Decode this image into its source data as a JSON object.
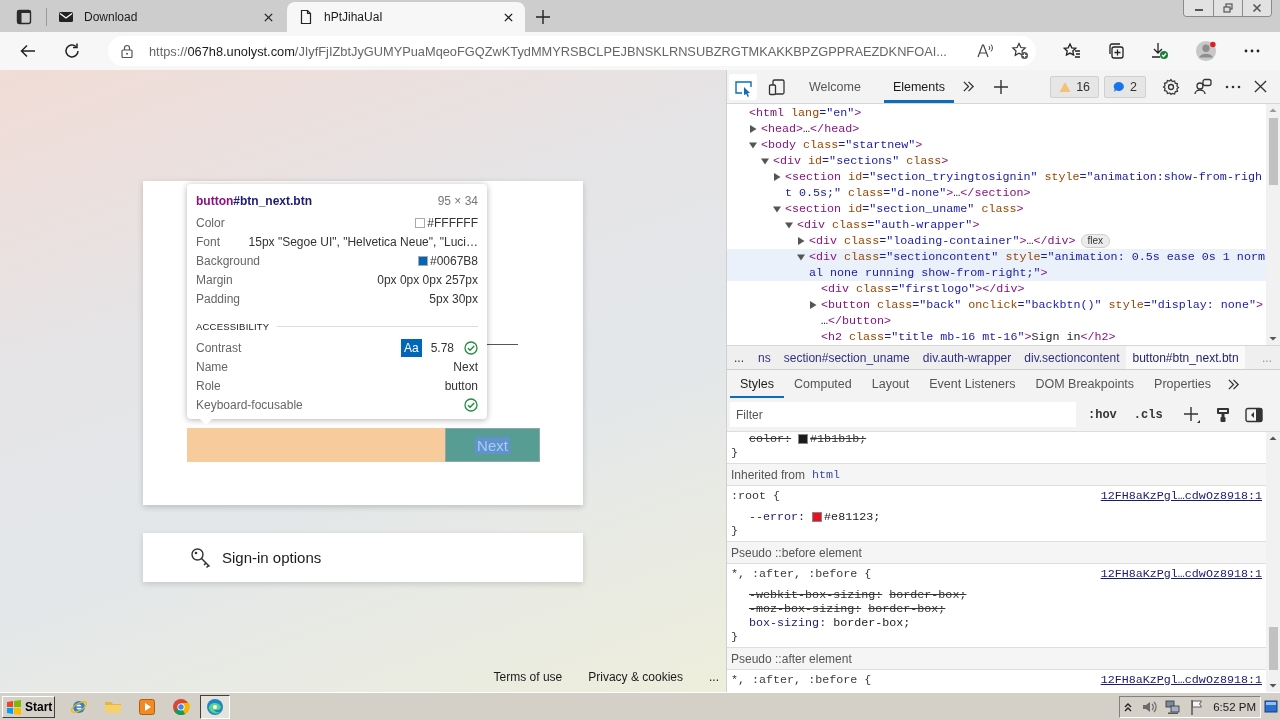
{
  "browser": {
    "tabs": [
      {
        "title": "Download",
        "selected": false
      },
      {
        "title": "hPtJihaUaI",
        "selected": true
      }
    ],
    "address": {
      "scheme": "https://",
      "host": "067h8.unolyst.com",
      "path": "/JIyfFjIZbtJyGUMYPuaMqeoFGQZwKTydMMYRSBCLPEJBNSKLRNSUBZRGTMKAKKBPZGPPRAEZDKNFOAI..."
    }
  },
  "page": {
    "inspect_tooltip": {
      "selector": {
        "tag": "button",
        "rest": "#btn_next.btn"
      },
      "size": "95 × 34",
      "properties": [
        {
          "kind": "color",
          "label": "Color",
          "value": "#FFFFFF",
          "color": "#ffffff"
        },
        {
          "kind": "text",
          "label": "Font",
          "value": "15px \"Segoe UI\", \"Helvetica Neue\", \"Luci…"
        },
        {
          "kind": "color",
          "label": "Background",
          "value": "#0067B8",
          "color": "#0067b8"
        },
        {
          "kind": "text",
          "label": "Margin",
          "value": "0px 0px 0px 257px"
        },
        {
          "kind": "text",
          "label": "Padding",
          "value": "5px 30px"
        }
      ],
      "accessibility_heading": "ACCESSIBILITY",
      "accessibility": [
        {
          "kind": "contrast",
          "label": "Contrast",
          "sample": "Aa",
          "value": "5.78",
          "passed": true
        },
        {
          "kind": "text",
          "label": "Name",
          "value": "Next"
        },
        {
          "kind": "text",
          "label": "Role",
          "value": "button"
        },
        {
          "kind": "check",
          "label": "Keyboard-focusable",
          "passed": true
        }
      ]
    },
    "next_button": {
      "label": "Next"
    },
    "sign_in_options": {
      "label": "Sign-in options"
    },
    "footer_links": [
      "Terms of use",
      "Privacy & cookies",
      "..."
    ]
  },
  "devtools": {
    "inspect_active": true,
    "tabs": [
      {
        "label": "Welcome",
        "selected": false
      },
      {
        "label": "Elements",
        "selected": true
      }
    ],
    "issues": {
      "warnings": "16",
      "messages": "2"
    },
    "dom_tree": [
      {
        "collapsible": false,
        "expanded": true,
        "highlighted": false,
        "tokens": [
          {
            "kind": "tag",
            "text": "<html"
          },
          {
            "kind": "attr",
            "text": " lang"
          },
          {
            "kind": "value",
            "text": "=\"en\""
          },
          {
            "kind": "tag",
            "text": ">"
          }
        ],
        "children": [
          {
            "collapsible": true,
            "expanded": false,
            "highlighted": false,
            "tokens": [
              {
                "kind": "tag",
                "text": "<head>"
              }
            ],
            "tail": [
              {
                "kind": "text",
                "text": "…"
              },
              {
                "kind": "tag",
                "text": "</head>"
              }
            ]
          },
          {
            "collapsible": true,
            "expanded": true,
            "highlighted": false,
            "tokens": [
              {
                "kind": "tag",
                "text": "<body"
              },
              {
                "kind": "attr",
                "text": " class"
              },
              {
                "kind": "value",
                "text": "=\"startnew\""
              },
              {
                "kind": "tag",
                "text": ">"
              }
            ],
            "children": [
              {
                "collapsible": true,
                "expanded": true,
                "highlighted": false,
                "tokens": [
                  {
                    "kind": "tag",
                    "text": "<div"
                  },
                  {
                    "kind": "attr",
                    "text": " id"
                  },
                  {
                    "kind": "value",
                    "text": "=\"sections\""
                  },
                  {
                    "kind": "attr",
                    "text": " class"
                  },
                  {
                    "kind": "tag",
                    "text": ">"
                  }
                ],
                "children": [
                  {
                    "collapsible": true,
                    "expanded": false,
                    "highlighted": false,
                    "tokens": [
                      {
                        "kind": "tag",
                        "text": "<section"
                      },
                      {
                        "kind": "attr",
                        "text": " id"
                      },
                      {
                        "kind": "value",
                        "text": "=\"section_tryingtosignin\""
                      },
                      {
                        "kind": "attr",
                        "text": " style"
                      },
                      {
                        "kind": "value",
                        "text": "=\"animation:show-from-right 0.5s;\""
                      },
                      {
                        "kind": "attr",
                        "text": " class"
                      },
                      {
                        "kind": "value",
                        "text": "=\"d-none\""
                      },
                      {
                        "kind": "tag",
                        "text": ">"
                      }
                    ],
                    "tail": [
                      {
                        "kind": "text",
                        "text": "…"
                      },
                      {
                        "kind": "tag",
                        "text": "</section>"
                      }
                    ]
                  },
                  {
                    "collapsible": true,
                    "expanded": true,
                    "highlighted": false,
                    "tokens": [
                      {
                        "kind": "tag",
                        "text": "<section"
                      },
                      {
                        "kind": "attr",
                        "text": " id"
                      },
                      {
                        "kind": "value",
                        "text": "=\"section_uname\""
                      },
                      {
                        "kind": "attr",
                        "text": " class"
                      },
                      {
                        "kind": "tag",
                        "text": ">"
                      }
                    ],
                    "children": [
                      {
                        "collapsible": true,
                        "expanded": true,
                        "highlighted": false,
                        "tokens": [
                          {
                            "kind": "tag",
                            "text": "<div"
                          },
                          {
                            "kind": "attr",
                            "text": " class"
                          },
                          {
                            "kind": "value",
                            "text": "=\"auth-wrapper\""
                          },
                          {
                            "kind": "tag",
                            "text": ">"
                          }
                        ],
                        "children": [
                          {
                            "collapsible": true,
                            "expanded": false,
                            "highlighted": false,
                            "badge": "flex",
                            "tokens": [
                              {
                                "kind": "tag",
                                "text": "<div"
                              },
                              {
                                "kind": "attr",
                                "text": " class"
                              },
                              {
                                "kind": "value",
                                "text": "=\"loading-container\""
                              },
                              {
                                "kind": "tag",
                                "text": ">"
                              }
                            ],
                            "tail": [
                              {
                                "kind": "text",
                                "text": "…"
                              },
                              {
                                "kind": "tag",
                                "text": "</div>"
                              }
                            ]
                          },
                          {
                            "collapsible": true,
                            "expanded": true,
                            "highlighted": true,
                            "tokens": [
                              {
                                "kind": "tag",
                                "text": "<div"
                              },
                              {
                                "kind": "attr",
                                "text": " class"
                              },
                              {
                                "kind": "value",
                                "text": "=\"sectioncontent\""
                              },
                              {
                                "kind": "attr",
                                "text": " style"
                              },
                              {
                                "kind": "value",
                                "text": "=\"animation: 0.5s ease 0s 1 normal none running show-from-right;\""
                              },
                              {
                                "kind": "tag",
                                "text": ">"
                              }
                            ],
                            "children": [
                              {
                                "collapsible": false,
                                "expanded": false,
                                "highlighted": false,
                                "tokens": [
                                  {
                                    "kind": "tag",
                                    "text": "<div"
                                  },
                                  {
                                    "kind": "attr",
                                    "text": " class"
                                  },
                                  {
                                    "kind": "value",
                                    "text": "=\"firstlogo\""
                                  },
                                  {
                                    "kind": "tag",
                                    "text": ">"
                                  }
                                ],
                                "tail": [
                                  {
                                    "kind": "tag",
                                    "text": "</div>"
                                  }
                                ]
                              },
                              {
                                "collapsible": true,
                                "expanded": false,
                                "highlighted": false,
                                "tokens": [
                                  {
                                    "kind": "tag",
                                    "text": "<button"
                                  },
                                  {
                                    "kind": "attr",
                                    "text": " class"
                                  },
                                  {
                                    "kind": "value",
                                    "text": "=\"back\""
                                  },
                                  {
                                    "kind": "attr",
                                    "text": " onclick"
                                  },
                                  {
                                    "kind": "value",
                                    "text": "=\"backbtn()\""
                                  },
                                  {
                                    "kind": "attr",
                                    "text": " style"
                                  },
                                  {
                                    "kind": "value",
                                    "text": "=\"display: none\""
                                  },
                                  {
                                    "kind": "tag",
                                    "text": ">"
                                  }
                                ],
                                "tail": [
                                  {
                                    "kind": "text",
                                    "text": "…"
                                  },
                                  {
                                    "kind": "tag",
                                    "text": "</button>"
                                  }
                                ]
                              },
                              {
                                "collapsible": false,
                                "expanded": false,
                                "highlighted": false,
                                "tokens": [
                                  {
                                    "kind": "tag",
                                    "text": "<h2"
                                  },
                                  {
                                    "kind": "attr",
                                    "text": " class"
                                  },
                                  {
                                    "kind": "value",
                                    "text": "=\"title mb-16 mt-16\""
                                  },
                                  {
                                    "kind": "tag",
                                    "text": ">"
                                  }
                                ],
                                "tail": [
                                  {
                                    "kind": "text",
                                    "text": "Sign in"
                                  },
                                  {
                                    "kind": "tag",
                                    "text": "</h2>"
                                  }
                                ]
                              }
                            ]
                          }
                        ]
                      }
                    ]
                  }
                ]
              }
            ]
          }
        ]
      }
    ],
    "breadcrumbs": {
      "scroll_left": "...",
      "items": [
        {
          "label": "ns",
          "selected": false
        },
        {
          "label": "section#section_uname",
          "selected": false
        },
        {
          "label": "div.auth-wrapper",
          "selected": false
        },
        {
          "label": "div.sectioncontent",
          "selected": false
        },
        {
          "label": "button#btn_next.btn",
          "selected": true
        }
      ],
      "scroll_right": "..."
    },
    "panel_tabs": [
      {
        "label": "Styles",
        "selected": true
      },
      {
        "label": "Computed",
        "selected": false
      },
      {
        "label": "Layout",
        "selected": false
      },
      {
        "label": "Event Listeners",
        "selected": false
      },
      {
        "label": "DOM Breakpoints",
        "selected": false
      },
      {
        "label": "Properties",
        "selected": false
      }
    ],
    "filter": {
      "placeholder": "Filter",
      "tools": [
        ":hov",
        ".cls"
      ]
    },
    "styles": [
      {
        "kind": "rule",
        "declarations": [
          {
            "name": "color:",
            "value": "#1b1b1b;",
            "color": "#1b1b1b",
            "overridden": true
          }
        ],
        "closing": "}"
      },
      {
        "kind": "header",
        "label": "Inherited from",
        "link": "html"
      },
      {
        "kind": "rule",
        "selector": ":root {",
        "source": "12FH8aKzPgl…cdwOz8918:1",
        "declarations": [
          {
            "name": "--error:",
            "value": "#e81123;",
            "color": "#e81123",
            "overridden": false
          }
        ],
        "closing": "}"
      },
      {
        "kind": "header",
        "label": "Pseudo ::before element"
      },
      {
        "kind": "rule",
        "selector": "*, :after, :before {",
        "source": "12FH8aKzPgl…cdwOz8918:1",
        "declarations": [
          {
            "name": "-webkit-box-sizing:",
            "value": "border-box;",
            "overridden": true
          },
          {
            "name": "-moz-box-sizing:",
            "value": "border-box;",
            "overridden": true
          },
          {
            "name": "box-sizing:",
            "value": "border-box;",
            "overridden": false
          }
        ],
        "closing": "}"
      },
      {
        "kind": "header",
        "label": "Pseudo ::after element"
      },
      {
        "kind": "rule",
        "selector": "*, :after, :before {",
        "source": "12FH8aKzPgl…cdwOz8918:1"
      }
    ]
  },
  "taskbar": {
    "start": "Start",
    "apps": [
      {
        "active": false
      },
      {
        "active": false
      },
      {
        "active": false
      },
      {
        "active": false
      },
      {
        "active": true
      }
    ],
    "clock": "6:52 PM"
  }
}
